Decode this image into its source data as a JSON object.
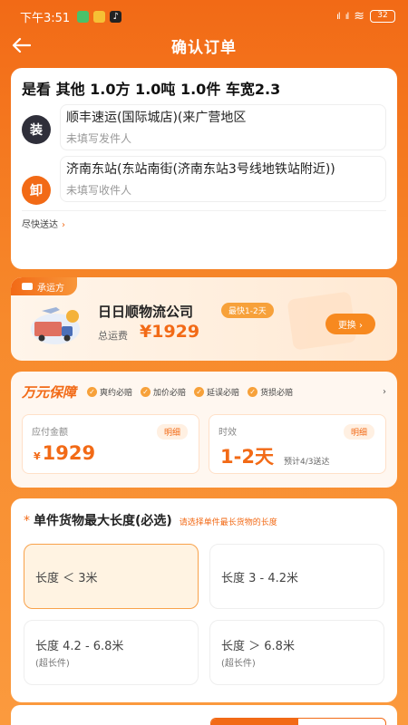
{
  "status_bar": {
    "time": "下午3:51",
    "battery": "32",
    "signal": "HD"
  },
  "nav": {
    "title": "确认订单"
  },
  "route": {
    "cargo_summary": "是看 其他 1.0方 1.0吨 1.0件 车宽2.3",
    "load": {
      "badge": "装",
      "address": "顺丰速运(国际城店)(来广营地区",
      "contact": "未填写发件人"
    },
    "unload": {
      "badge": "卸",
      "address": "济南东站(东站南街(济南东站3号线地铁站附近))",
      "contact": "未填写收件人"
    },
    "footer": "尽快送达"
  },
  "carrier": {
    "tag": "承运方",
    "name": "日日顺物流公司",
    "fast_badge": "最快1-2天",
    "freight_label": "总运费",
    "freight_value": "¥1929",
    "change_label": "更换"
  },
  "guarantee": {
    "title": "万元保障",
    "items": [
      "爽约必赔",
      "加价必赔",
      "延误必赔",
      "货损必赔"
    ],
    "pay": {
      "label": "应付金额",
      "detail": "明细",
      "currency": "¥",
      "value": "1929"
    },
    "time": {
      "label": "时效",
      "detail": "明细",
      "value": "1-2天",
      "note": "预计4/3送达"
    }
  },
  "length": {
    "required_mark": "*",
    "title": "单件货物最大长度(必选)",
    "hint": "请选择单件最长货物的长度",
    "options": [
      {
        "label": "长度 ＜ 3米",
        "sub": ""
      },
      {
        "label": "长度 3 - 4.2米",
        "sub": ""
      },
      {
        "label": "长度 4.2 - 6.8米",
        "sub": "(超长件)"
      },
      {
        "label": "长度 ＞ 6.8米",
        "sub": "(超长件)"
      }
    ],
    "selected_index": 0
  },
  "bottom": {
    "left_text": "",
    "seg_left": "",
    "seg_right": ""
  },
  "colors": {
    "accent": "#f26a16",
    "badge_dark": "#2f2f3a"
  }
}
